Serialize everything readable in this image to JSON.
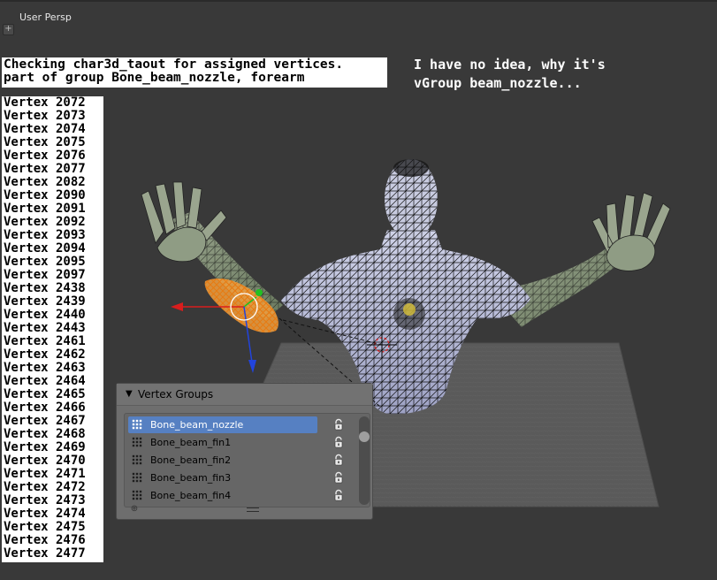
{
  "viewport": {
    "label": "User Persp"
  },
  "info_box": {
    "lines": [
      "Checking char3d_taout for assigned vertices.",
      "part of group Bone_beam_nozzle, forearm"
    ]
  },
  "note": {
    "lines": [
      "I have no idea, why it's",
      "vGroup beam_nozzle..."
    ]
  },
  "vertices": [
    "Vertex 2072",
    "Vertex 2073",
    "Vertex 2074",
    "Vertex 2075",
    "Vertex 2076",
    "Vertex 2077",
    "Vertex 2082",
    "Vertex 2090",
    "Vertex 2091",
    "Vertex 2092",
    "Vertex 2093",
    "Vertex 2094",
    "Vertex 2095",
    "Vertex 2097",
    "Vertex 2438",
    "Vertex 2439",
    "Vertex 2440",
    "Vertex 2443",
    "Vertex 2461",
    "Vertex 2462",
    "Vertex 2463",
    "Vertex 2464",
    "Vertex 2465",
    "Vertex 2466",
    "Vertex 2467",
    "Vertex 2468",
    "Vertex 2469",
    "Vertex 2470",
    "Vertex 2471",
    "Vertex 2472",
    "Vertex 2473",
    "Vertex 2474",
    "Vertex 2475",
    "Vertex 2476",
    "Vertex 2477"
  ],
  "vertex_groups_panel": {
    "title": "Vertex Groups",
    "items": [
      {
        "name": "Bone_beam_nozzle",
        "active": true,
        "icon": "vertex-group-icon",
        "lock_icon": "lock-icon"
      },
      {
        "name": "Bone_beam_fin1",
        "active": false,
        "icon": "vertex-group-icon",
        "lock_icon": "lock-icon"
      },
      {
        "name": "Bone_beam_fin2",
        "active": false,
        "icon": "vertex-group-icon",
        "lock_icon": "lock-icon"
      },
      {
        "name": "Bone_beam_fin3",
        "active": false,
        "icon": "vertex-group-icon",
        "lock_icon": "lock-icon"
      },
      {
        "name": "Bone_beam_fin4",
        "active": false,
        "icon": "vertex-group-icon",
        "lock_icon": "lock-icon"
      }
    ]
  },
  "colors": {
    "viewport_bg": "#393939",
    "selection": "#f08a1c",
    "active_row": "#5680c2",
    "axis_x": "#d91d1d",
    "axis_y": "#22c022",
    "axis_z": "#2244dd"
  }
}
